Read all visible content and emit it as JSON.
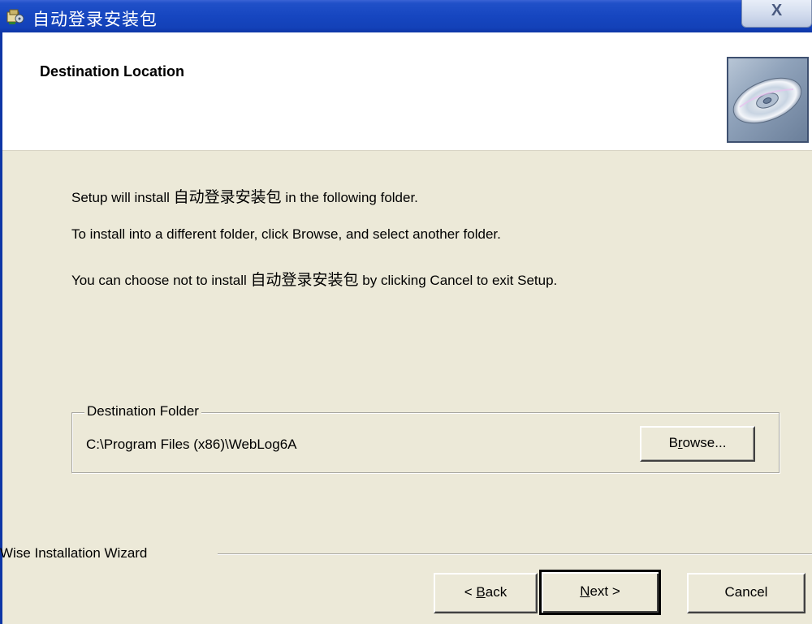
{
  "window": {
    "title": "自动登录安装包",
    "close_glyph": "X"
  },
  "header": {
    "title": "Destination Location",
    "cd_icon": "cd-disc-icon"
  },
  "body": {
    "line1_pre": "Setup will install ",
    "line1_app": "自动登录安装包",
    "line1_post": " in the following folder.",
    "line2": "To install into a different folder, click Browse, and select another folder.",
    "line3_pre": "You can choose not to install ",
    "line3_app": "自动登录安装包",
    "line3_post": " by clicking Cancel to exit Setup."
  },
  "destination": {
    "group_label": "Destination Folder",
    "path": "C:\\Program Files (x86)\\WebLog6A",
    "browse_pre": "B",
    "browse_accel": "r",
    "browse_post": "owse..."
  },
  "footer": {
    "wizard_label": "Wise Installation Wizard",
    "back_pre": "< ",
    "back_accel": "B",
    "back_post": "ack",
    "next_accel": "N",
    "next_post": "ext >",
    "cancel": "Cancel"
  }
}
